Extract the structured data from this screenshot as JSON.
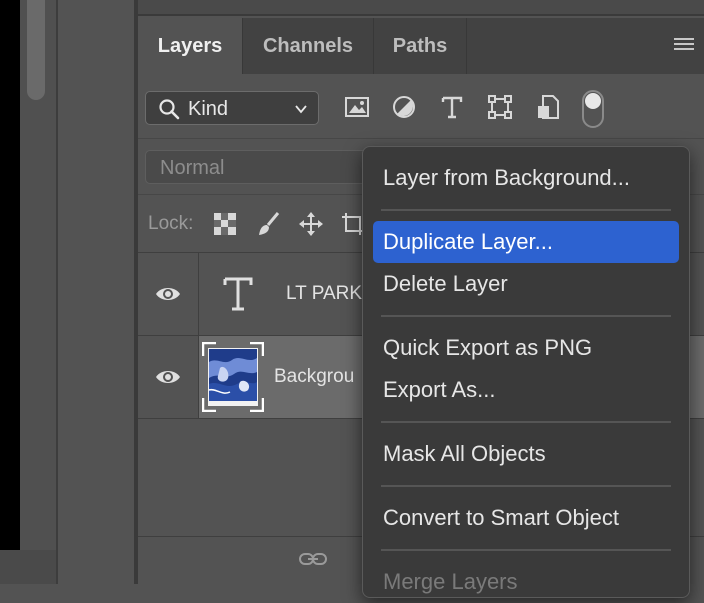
{
  "panel": {
    "tabs": [
      {
        "label": "Layers",
        "active": true
      },
      {
        "label": "Channels",
        "active": false
      },
      {
        "label": "Paths",
        "active": false
      }
    ]
  },
  "filter": {
    "kind_label": "Kind",
    "icons": [
      "image-filter-icon",
      "adjustment-filter-icon",
      "type-filter-icon",
      "shape-filter-icon",
      "smart-object-filter-icon"
    ]
  },
  "blend": {
    "mode": "Normal"
  },
  "lock": {
    "label": "Lock:"
  },
  "layers": [
    {
      "name": "LT PARK",
      "type": "text",
      "visible": true
    },
    {
      "name": "Backgrou",
      "type": "image",
      "visible": true,
      "selected": true
    }
  ],
  "context_menu": {
    "items": [
      {
        "label": "Layer from Background..."
      },
      {
        "label": "Duplicate Layer...",
        "highlighted": true
      },
      {
        "label": "Delete Layer"
      },
      {
        "label": "Quick Export as PNG"
      },
      {
        "label": "Export As..."
      },
      {
        "label": "Mask All Objects"
      },
      {
        "label": "Convert to Smart Object"
      },
      {
        "label": "Merge Layers",
        "disabled": true
      }
    ]
  },
  "colors": {
    "highlight": "#2d62d0",
    "panel_bg": "#535353",
    "menu_bg": "#3a3a3a"
  }
}
